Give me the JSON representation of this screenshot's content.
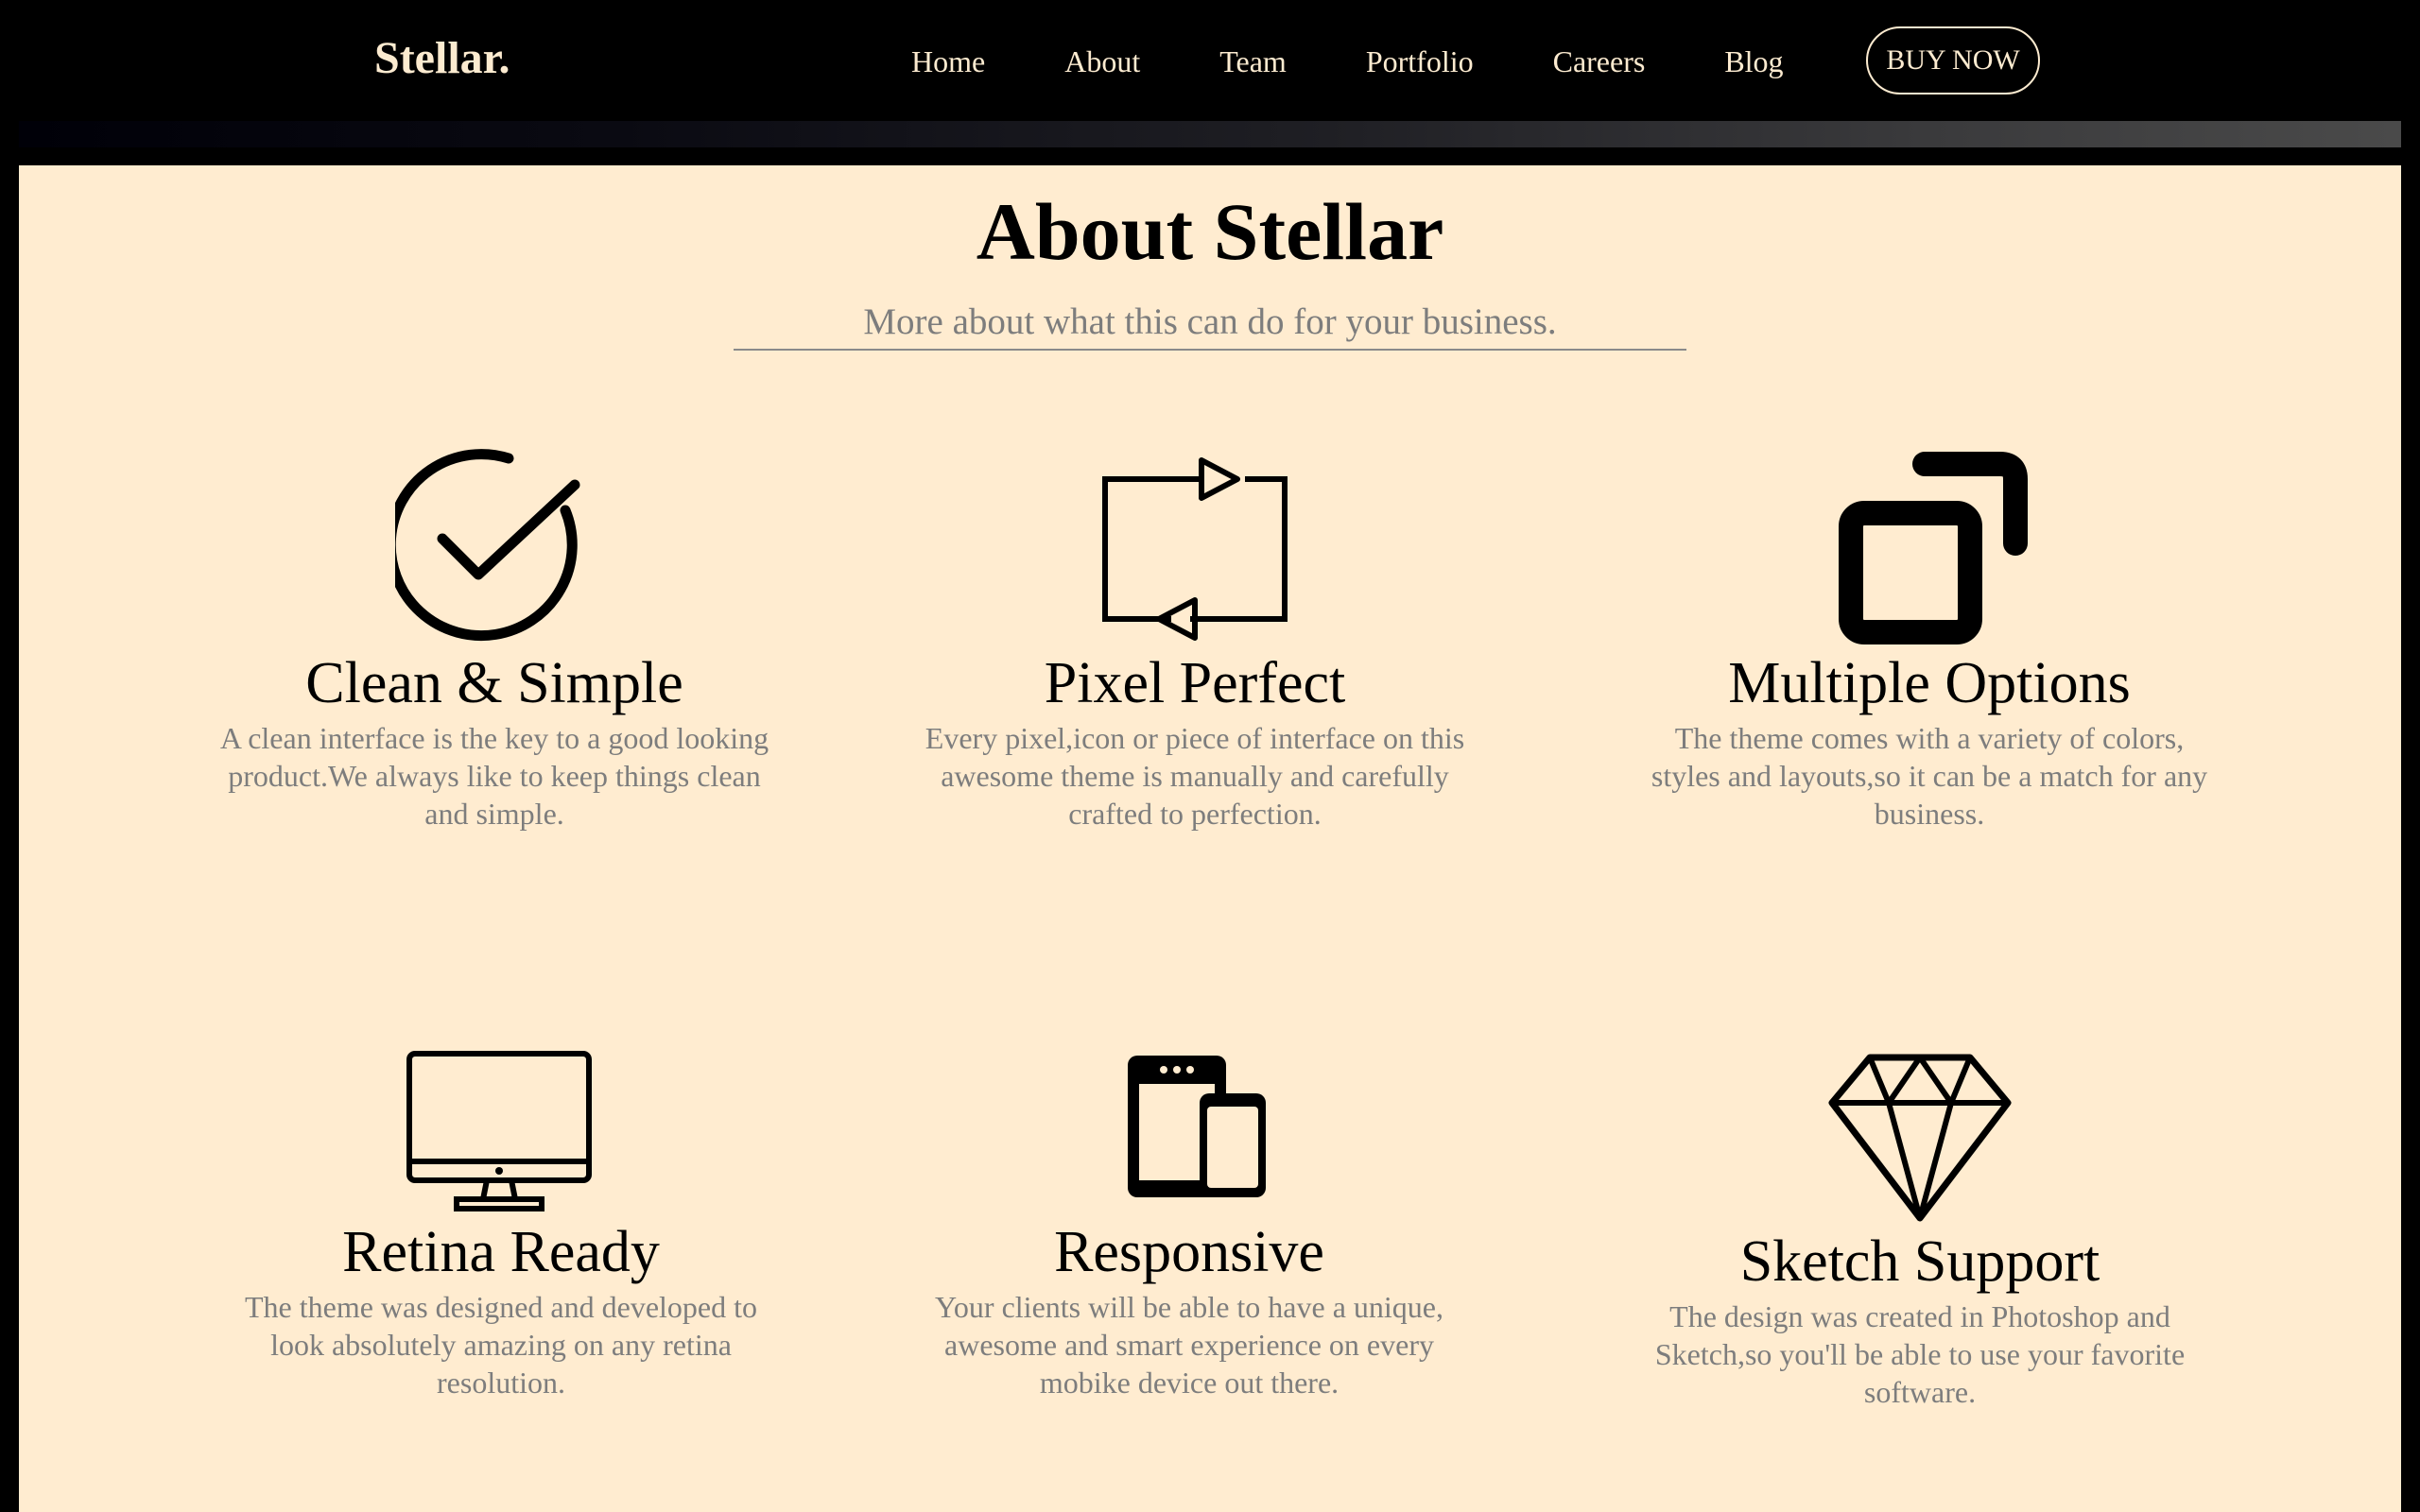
{
  "navbar": {
    "brand": "Stellar.",
    "links": [
      "Home",
      "About",
      "Team",
      "Portfolio",
      "Careers",
      "Blog"
    ],
    "cta": "BUY NOW"
  },
  "about": {
    "title": "About Stellar",
    "subtitle": "More about what this can do for your business.",
    "features": [
      {
        "icon": "check-circle-icon",
        "title": "Clean & Simple",
        "text": "A clean interface is the key to a good looking product.We always like to keep things clean and simple."
      },
      {
        "icon": "repeat-arrows-icon",
        "title": "Pixel Perfect",
        "text": "Every pixel,icon or piece of interface on this awesome theme is manually and carefully crafted to perfection."
      },
      {
        "icon": "overlapping-squares-icon",
        "title": "Multiple Options",
        "text": "The theme comes with a variety of colors, styles and layouts,so it can be a match for any business."
      },
      {
        "icon": "monitor-icon",
        "title": "Retina Ready",
        "text": "The theme was designed and developed to look absolutely amazing on any retina resolution."
      },
      {
        "icon": "tablet-phone-icon",
        "title": "Responsive",
        "text": "Your clients will be able to have a unique, awesome and smart experience on every mobike device out there."
      },
      {
        "icon": "diamond-icon",
        "title": "Sketch Support",
        "text": "The design was created in Photoshop and Sketch,so you'll be able to use your favorite software."
      }
    ]
  },
  "colors": {
    "nav_background": "#000000",
    "nav_text": "#fcebd0",
    "section_background": "#ffecd0",
    "muted_text": "#7d7d7d"
  }
}
